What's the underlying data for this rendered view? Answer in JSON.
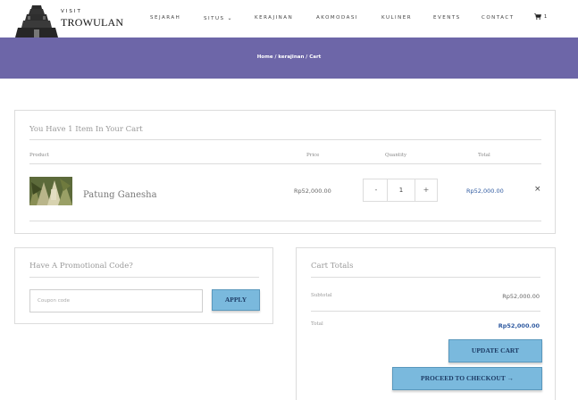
{
  "brand": {
    "visit": "VISIT",
    "name": "TROWULAN"
  },
  "nav": {
    "items": [
      "SEJARAH",
      "SITUS",
      "KERAJINAN",
      "AKOMODASI",
      "KULINER",
      "EVENTS",
      "CONTACT"
    ],
    "cart_count": "1"
  },
  "banner": {
    "breadcrumb": "Home / kerajinan / Cart"
  },
  "cart": {
    "title": "You Have 1 Item In Your Cart",
    "columns": {
      "product": "Product",
      "price": "Price",
      "quantity": "Quantity",
      "total": "Total"
    },
    "items": [
      {
        "name": "Patung Ganesha",
        "price": "Rp52,000.00",
        "quantity": "1",
        "minus": "-",
        "plus": "+",
        "total": "Rp52,000.00",
        "remove": "×"
      }
    ]
  },
  "promo": {
    "title": "Have A Promotional Code?",
    "placeholder": "Coupon code",
    "apply_label": "APPLY"
  },
  "totals": {
    "title": "Cart Totals",
    "subtotal_label": "Subtotal",
    "subtotal_value": "Rp52,000.00",
    "total_label": "Total",
    "total_value": "Rp52,000.00",
    "update_label": "UPDATE CART",
    "checkout_label": "PROCEED TO CHECKOUT →"
  },
  "colors": {
    "banner": "#6d66a8",
    "button": "#7ab9dd",
    "price_accent": "#2f5aa0"
  },
  "icons": {
    "situs_dropdown": "chevron-down-icon",
    "cart": "cart-icon",
    "logo": "temple-icon"
  }
}
